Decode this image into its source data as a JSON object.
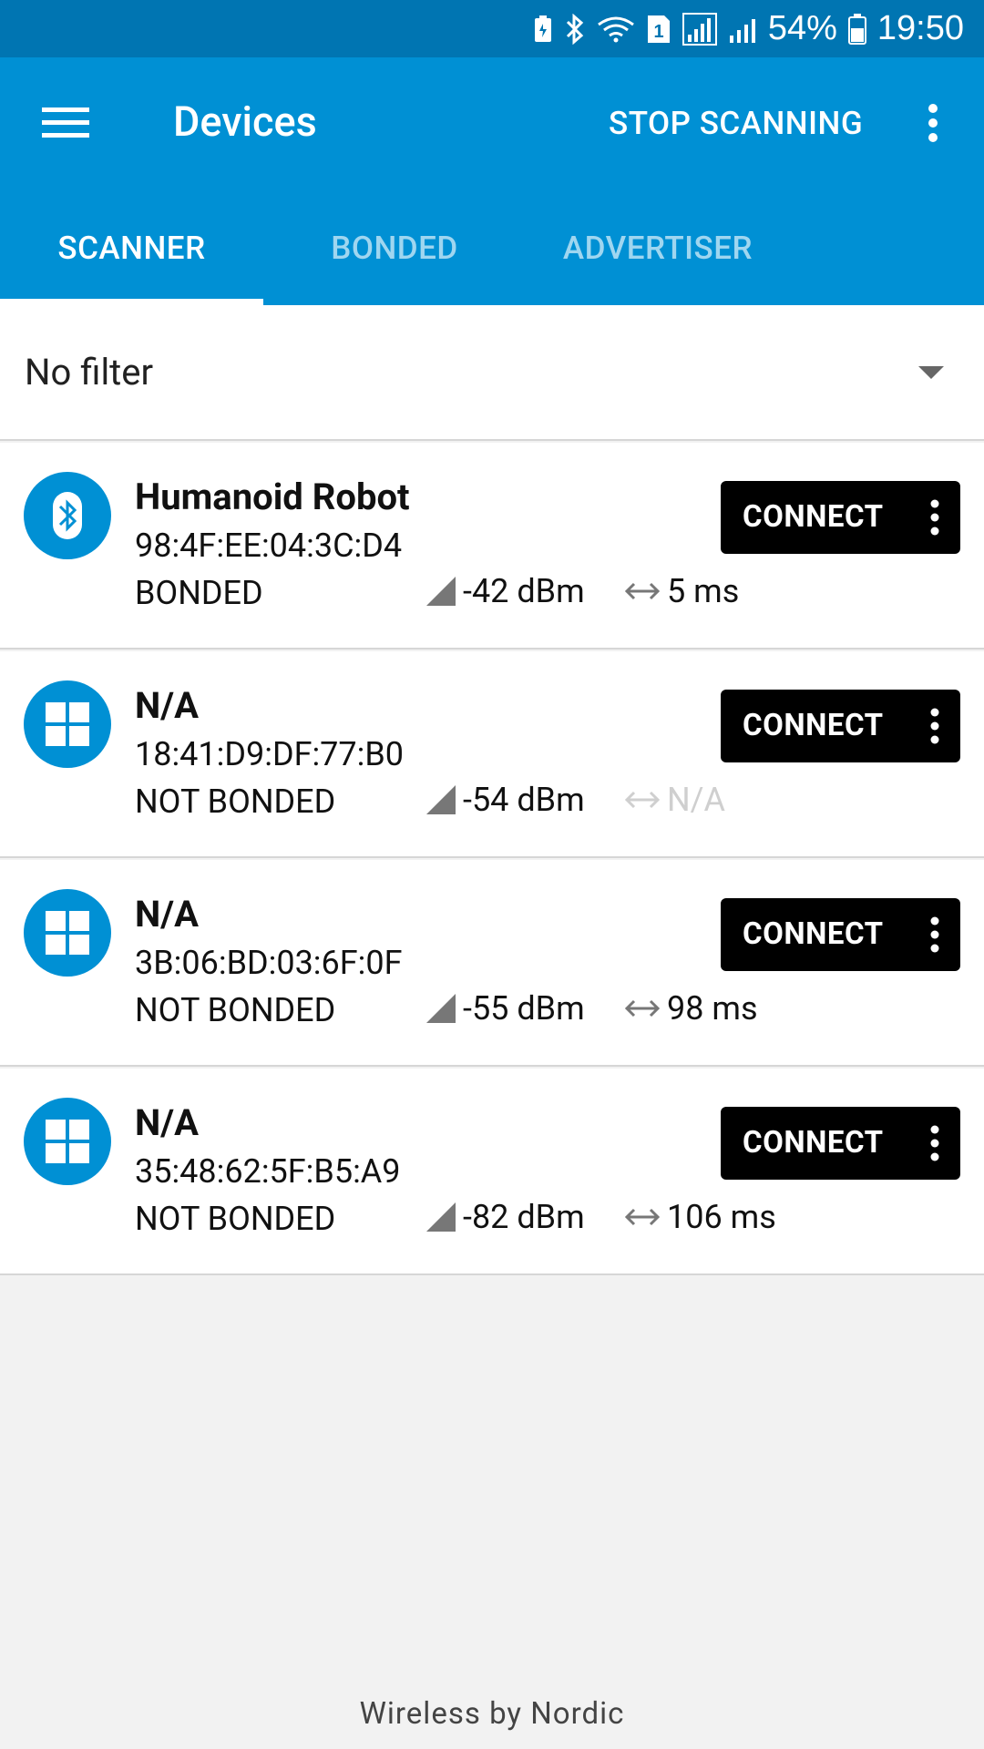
{
  "status_bar": {
    "battery_percent": "54%",
    "time": "19:50",
    "sim_badge": "1",
    "icons": [
      "battery-saver-icon",
      "bluetooth-icon",
      "wifi-icon",
      "sim-icon",
      "signal-icon",
      "signal-icon",
      "battery-icon"
    ]
  },
  "app_bar": {
    "title": "Devices",
    "action": "STOP SCANNING",
    "menu_icon": "hamburger-menu-icon",
    "overflow_icon": "more-vertical-icon"
  },
  "tabs": [
    {
      "label": "SCANNER",
      "active": true
    },
    {
      "label": "BONDED",
      "active": false
    },
    {
      "label": "ADVERTISER",
      "active": false
    }
  ],
  "filter": {
    "label": "No filter",
    "icon": "dropdown-arrow-icon"
  },
  "devices": [
    {
      "name": "Humanoid Robot",
      "address": "98:4F:EE:04:3C:D4",
      "bond_state": "BONDED",
      "rssi": "-42 dBm",
      "interval": "5 ms",
      "interval_available": true,
      "icon": "bluetooth-icon",
      "connect_label": "CONNECT"
    },
    {
      "name": "N/A",
      "address": "18:41:D9:DF:77:B0",
      "bond_state": "NOT BONDED",
      "rssi": "-54 dBm",
      "interval": "N/A",
      "interval_available": false,
      "icon": "windows-icon",
      "connect_label": "CONNECT"
    },
    {
      "name": "N/A",
      "address": "3B:06:BD:03:6F:0F",
      "bond_state": "NOT BONDED",
      "rssi": "-55 dBm",
      "interval": "98 ms",
      "interval_available": true,
      "icon": "windows-icon",
      "connect_label": "CONNECT"
    },
    {
      "name": "N/A",
      "address": "35:48:62:5F:B5:A9",
      "bond_state": "NOT BONDED",
      "rssi": "-82 dBm",
      "interval": "106 ms",
      "interval_available": true,
      "icon": "windows-icon",
      "connect_label": "CONNECT"
    }
  ],
  "footer": "Wireless by Nordic",
  "colors": {
    "primary": "#0090d4",
    "primary_dark": "#0075b2",
    "tab_inactive": "#9fd6f0",
    "button": "#000000",
    "background": "#f2f2f2"
  }
}
